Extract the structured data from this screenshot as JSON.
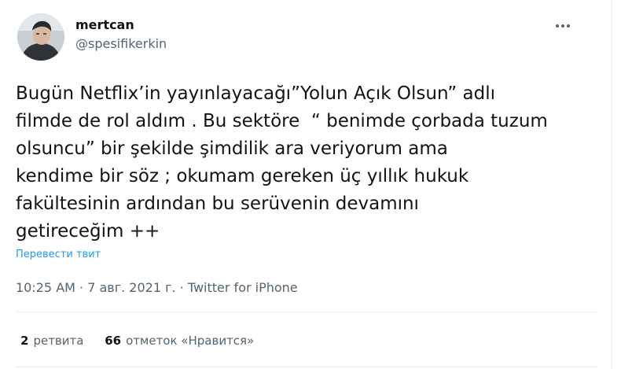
{
  "tweet": {
    "author": {
      "display_name": "mertcan",
      "handle": "@spesifikerkin"
    },
    "text": "Bugün Netflix’in yayınlayacağı”Yolun Açık Olsun” adlı\nfilmde de rol aldım . Bu sektöre  “ benimde çorbada tuzum\nolsuncu” bir şekilde şimdilik ara veriyorum ama\nkendime bir söz ; okumam gereken üç yıllık hukuk\nfakültesinin ardından bu serüvenin devamını\ngetireceğim ++",
    "translate_label": "Перевести твит",
    "timestamp": "10:25 AM · 7 авг. 2021 г.",
    "separator": " · ",
    "source": "Twitter for iPhone",
    "retweets": {
      "count": "2",
      "label": "ретвита"
    },
    "likes": {
      "count": "66",
      "label": "отметок «Нравится»"
    }
  },
  "colors": {
    "text": "#0f1419",
    "secondary": "#536471",
    "link": "#1d9bf0",
    "border": "#e6ecf0"
  },
  "icons": {
    "more": "more-horizontal-icon",
    "avatar": "profile-photo"
  }
}
